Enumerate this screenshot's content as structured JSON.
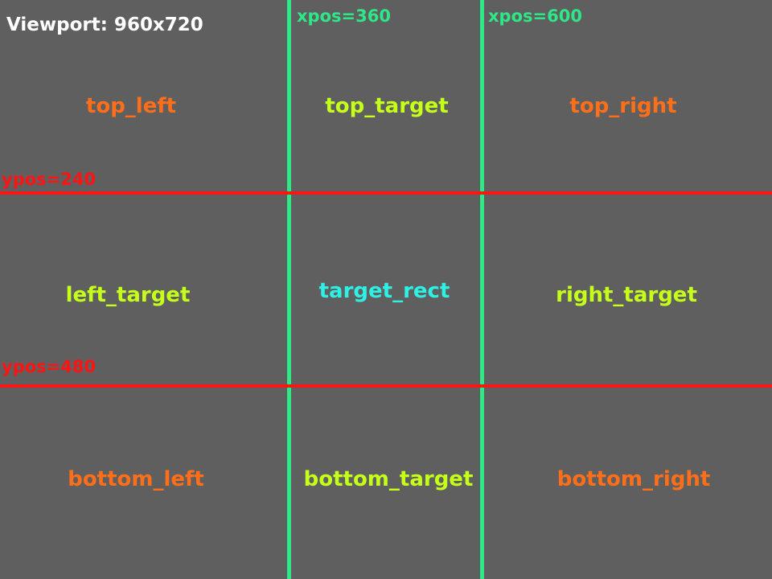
{
  "viewport_label": "Viewport: 960x720",
  "guides": {
    "x_labels": [
      "xpos=360",
      "xpos=600"
    ],
    "y_labels": [
      "ypos=240",
      "ypos=480"
    ]
  },
  "cells": {
    "top_left": "top_left",
    "top_target": "top_target",
    "top_right": "top_right",
    "left_target": "left_target",
    "target_rect": "target_rect",
    "right_target": "right_target",
    "bottom_left": "bottom_left",
    "bottom_target": "bottom_target",
    "bottom_right": "bottom_right"
  },
  "colors": {
    "background": "#5f5f5f",
    "vertical_guide": "#2ee888",
    "horizontal_guide": "#ff1414",
    "corner_text": "#ff6f1a",
    "edge_text": "#c6ff1a",
    "center_text": "#2ef0e4"
  }
}
